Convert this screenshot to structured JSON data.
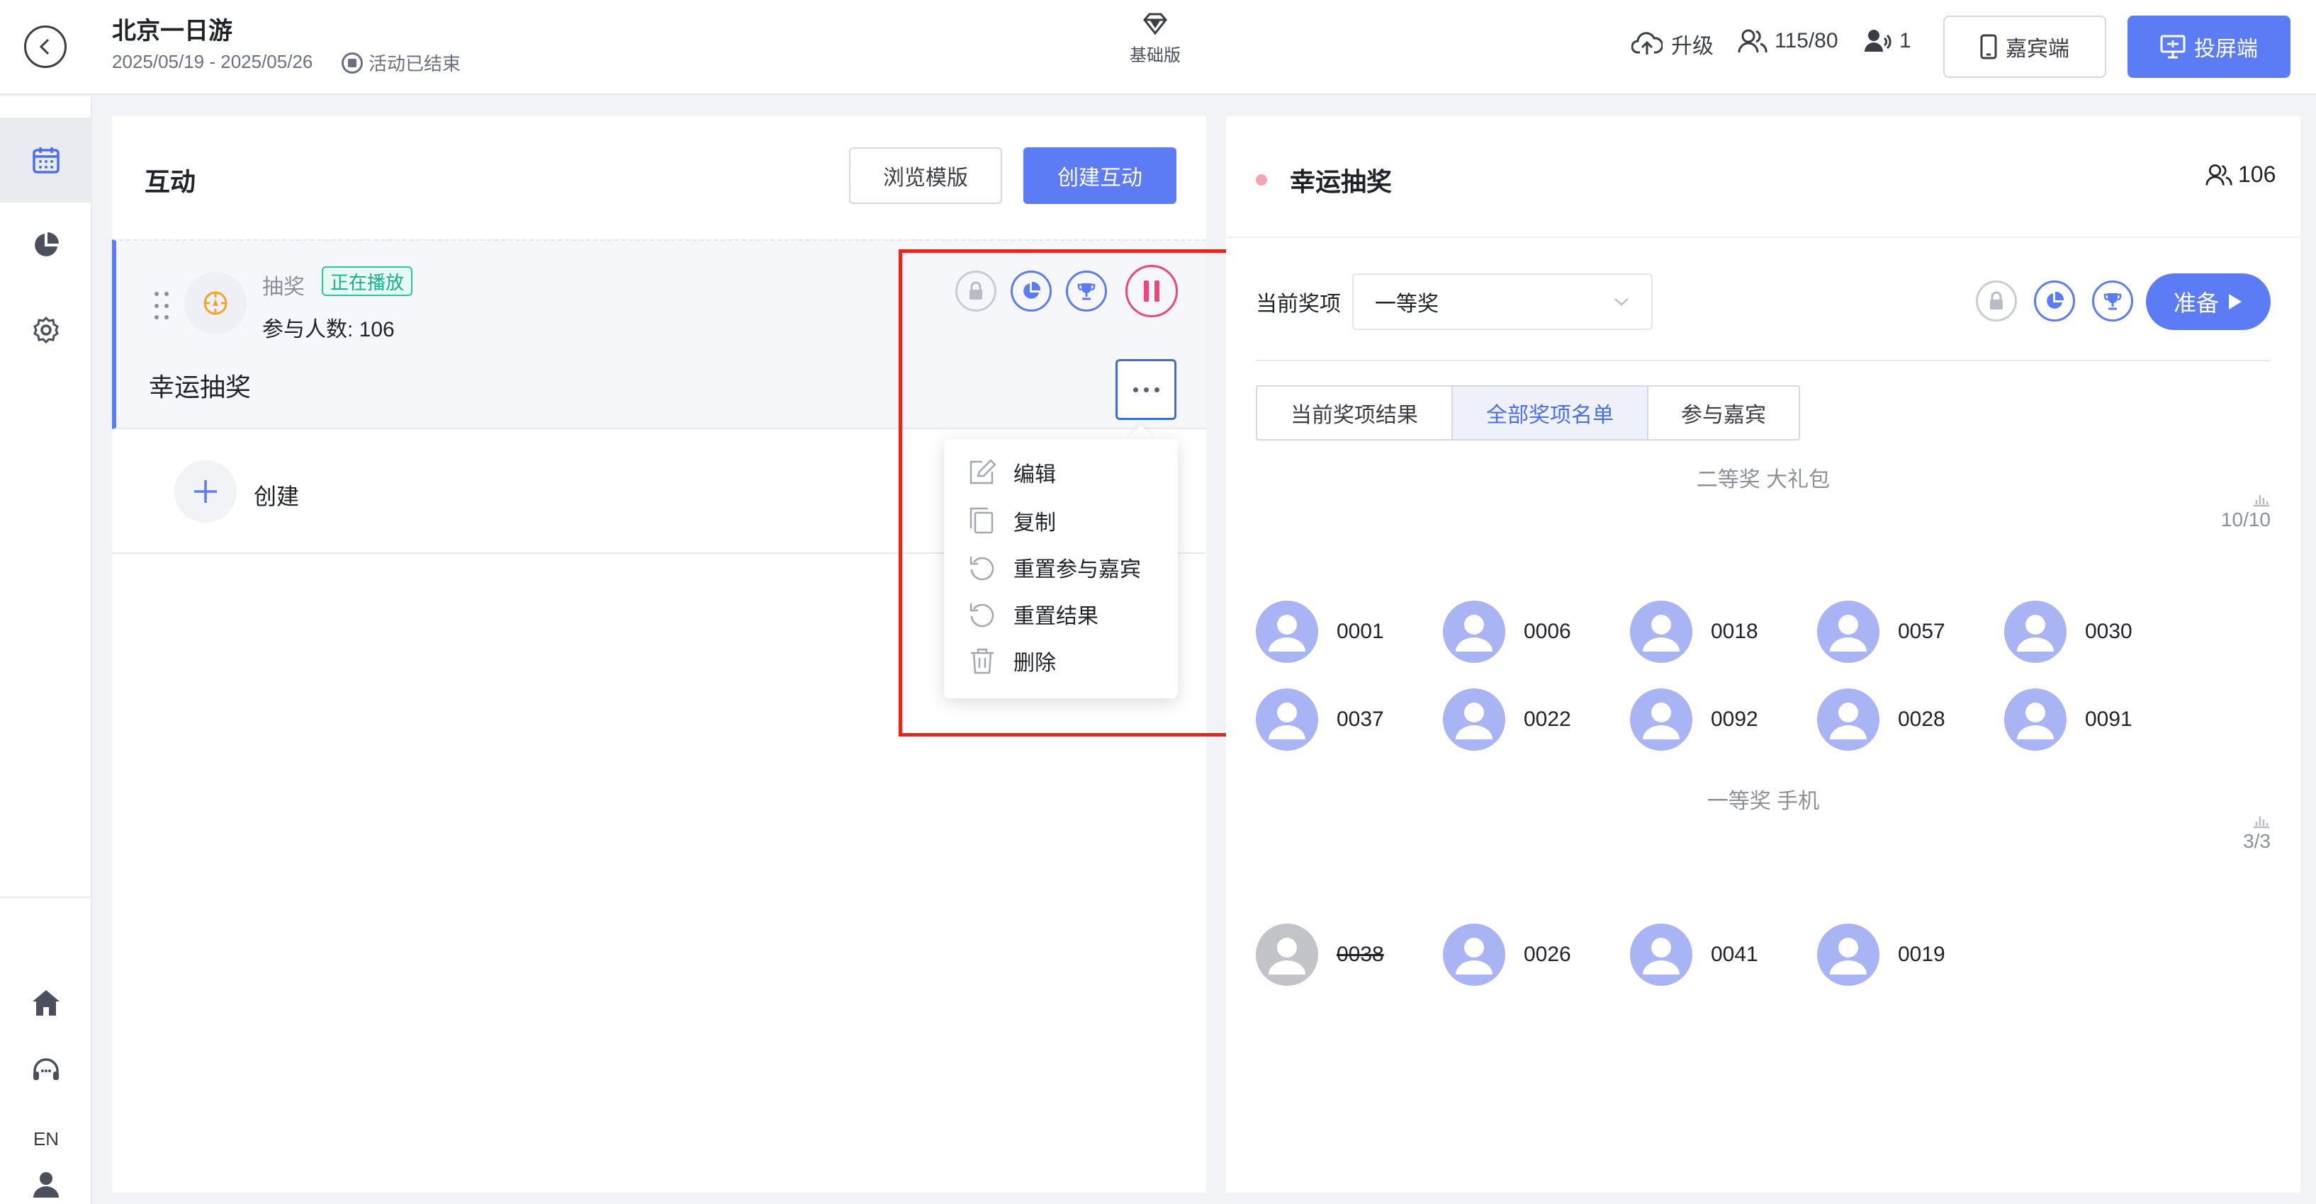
{
  "header": {
    "title": "北京一日游",
    "dates": "2025/05/19 - 2025/05/26",
    "status": "活动已结束",
    "plan": "基础版",
    "upgrade": "升级",
    "people": "115/80",
    "online": "1",
    "guest_btn": "嘉宾端",
    "screen_btn": "投屏端"
  },
  "sidebar": {
    "lang": "EN"
  },
  "left_panel": {
    "title": "互动",
    "browse_btn": "浏览模版",
    "create_btn": "创建互动",
    "card": {
      "type": "抽奖",
      "badge": "正在播放",
      "participants": "参与人数: 106",
      "name": "幸运抽奖"
    },
    "create_label": "创建",
    "menu": [
      "编辑",
      "复制",
      "重置参与嘉宾",
      "重置结果",
      "删除"
    ]
  },
  "right_panel": {
    "title": "幸运抽奖",
    "count": "106",
    "prize_label": "当前奖项",
    "prize_value": "一等奖",
    "ready_btn": "准备",
    "tabs": [
      "当前奖项结果",
      "全部奖项名单",
      "参与嘉宾"
    ],
    "groups": [
      {
        "title": "二等奖 大礼包",
        "meta": "10/10",
        "winners": [
          "0001",
          "0006",
          "0018",
          "0057",
          "0030",
          "0037",
          "0022",
          "0092",
          "0028",
          "0091"
        ]
      },
      {
        "title": "一等奖 手机",
        "meta": "3/3",
        "winners": [
          "0038",
          "0026",
          "0041",
          "0019"
        ]
      }
    ]
  },
  "colors": {
    "accent": "#5b7cf5",
    "live_badge": "#17b08a",
    "pause": "#f0447a",
    "highlight": "#e8251b"
  }
}
